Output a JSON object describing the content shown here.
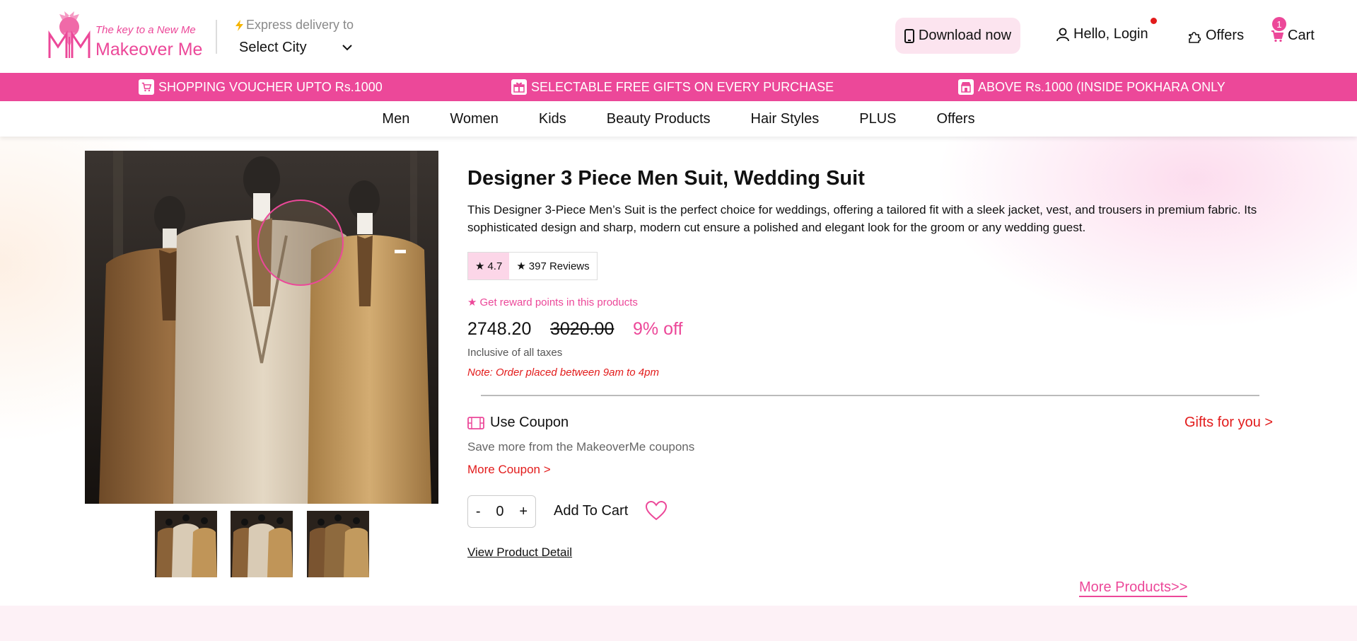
{
  "brand": {
    "tagline": "The key to a New Me",
    "name": "Makeover Me"
  },
  "header": {
    "express_label": "Express delivery to",
    "city_selected": "Select City",
    "download_label": "Download now",
    "login_label": "Hello, Login",
    "offers_label": "Offers",
    "cart_label": "Cart",
    "cart_count": "1"
  },
  "promo": [
    {
      "icon": "cart-icon",
      "text": "SHOPPING VOUCHER UPTO Rs.1000"
    },
    {
      "icon": "gift-icon",
      "text": "SELECTABLE FREE GIFTS ON EVERY PURCHASE"
    },
    {
      "icon": "store-icon",
      "text": "ABOVE Rs.1000 (INSIDE POKHARA ONLY"
    }
  ],
  "nav": [
    "Men",
    "Women",
    "Kids",
    "Beauty Products",
    "Hair Styles",
    "PLUS",
    "Offers"
  ],
  "product": {
    "title": "Designer 3 Piece Men Suit, Wedding Suit",
    "description": "This Designer 3-Piece Men’s Suit is the perfect choice for weddings, offering a tailored fit with a sleek jacket, vest, and trousers in premium fabric. Its sophisticated design and sharp, modern cut ensure a polished and elegant look for the groom or any wedding guest.",
    "rating": "4.7",
    "reviews": "397 Reviews",
    "reward_text": "Get reward points in this products",
    "price": "2748.20",
    "old_price": "3020.00",
    "discount": "9% off",
    "taxes_text": "Inclusive of all taxes",
    "note": "Note: Order placed between 9am to 4pm",
    "thumbnail_count": 3
  },
  "coupon": {
    "heading": "Use Coupon",
    "gifts_link": "Gifts for you >",
    "subtitle": "Save more from the MakeoverMe coupons",
    "more_link": "More Coupon >"
  },
  "cart_controls": {
    "minus": "-",
    "quantity": "0",
    "plus": "+",
    "add_label": "Add To Cart"
  },
  "links": {
    "view_detail": "View Product Detail",
    "more_products": "More Products>>"
  },
  "colors": {
    "accent": "#ec4899",
    "accent_light": "#fce4ef",
    "warning_red": "#e21b1b",
    "bolt_yellow": "#f5b400"
  }
}
